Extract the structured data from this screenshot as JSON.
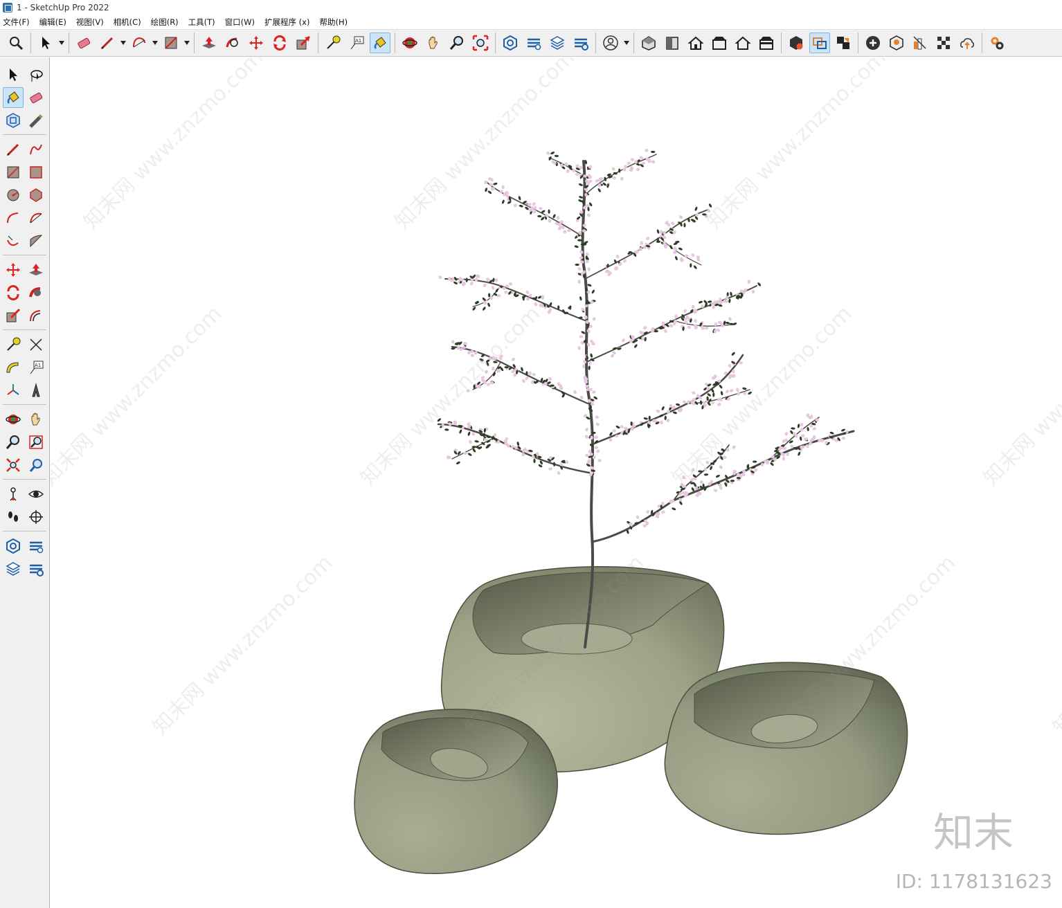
{
  "window": {
    "title": "1 - SketchUp Pro 2022"
  },
  "menubar": {
    "items": [
      "文件(F)",
      "编辑(E)",
      "视图(V)",
      "相机(C)",
      "绘图(R)",
      "工具(T)",
      "窗口(W)",
      "扩展程序 (x)",
      "帮助(H)"
    ]
  },
  "toolbar": {
    "icons": [
      "search-tool",
      "select-tool",
      "eraser-tool",
      "pencil-tool",
      "arc-tool",
      "rectangle-tool",
      "push-pull-tool",
      "follow-me-tool",
      "move-tool",
      "rotate-tool",
      "scale-tool",
      "tape-measure-tool",
      "text-tool",
      "paint-bucket-tool",
      "orbit-tool",
      "pan-tool",
      "zoom-tool",
      "zoom-extents-tool",
      "components-tool",
      "tags-tool",
      "layers-tool",
      "tags-settings-tool",
      "account-tool",
      "iso-view",
      "top-view",
      "front-view",
      "right-view",
      "back-view",
      "left-view",
      "extension-warehouse",
      "solid-tools",
      "section-tool",
      "add-location",
      "shadow-tool",
      "style-tool",
      "fog-tool",
      "cloud-tool",
      "settings-tool"
    ],
    "active": "paint-bucket-tool"
  },
  "left_toolbar": {
    "active": "paint-bucket-tool"
  },
  "viewport": {
    "watermark_text": "知末网 www.znzmo.com",
    "brand": "知末",
    "id_label": "ID: 1178131623",
    "colors": {
      "planter": "#9aa084",
      "planter_shadow": "#6a7058",
      "planter_inner": "#5d6350",
      "branch": "#4a4a46",
      "blossom": "#e8c6e0",
      "leaf": "#2f3d24"
    }
  }
}
